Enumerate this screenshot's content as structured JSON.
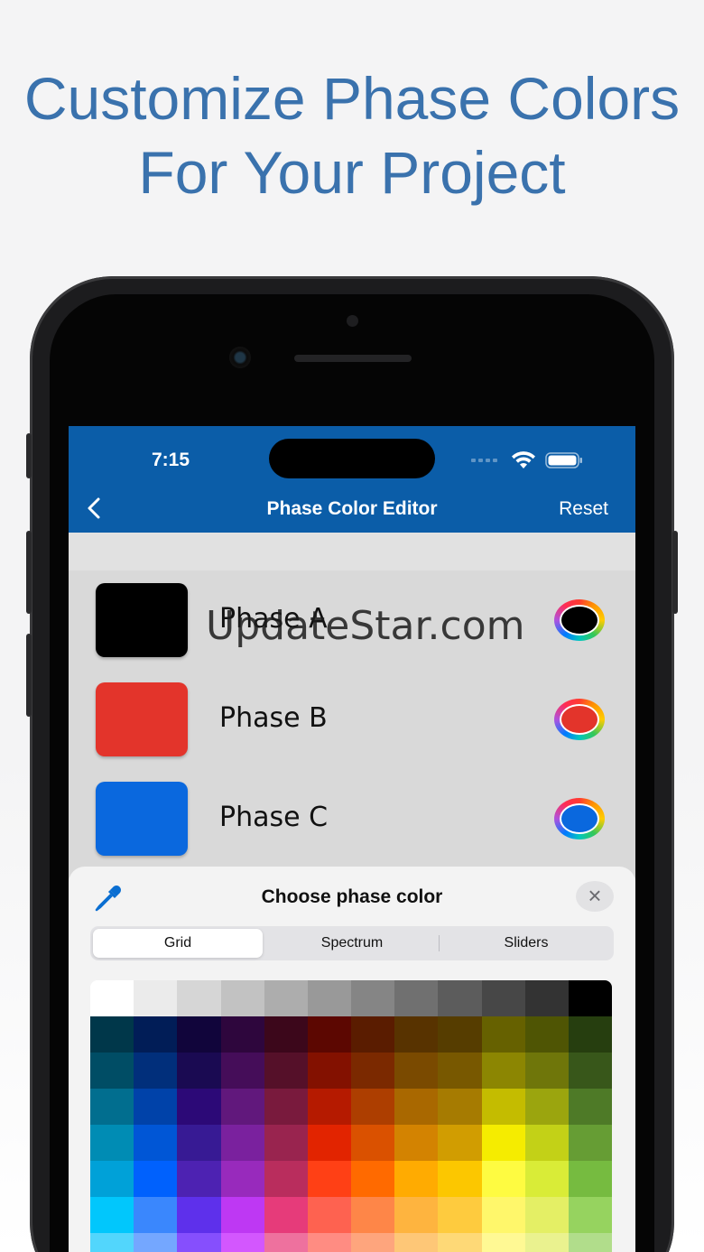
{
  "headline": {
    "line1": "Customize Phase Colors",
    "line2": "For Your Project"
  },
  "status_bar": {
    "time": "7:15"
  },
  "nav": {
    "back_icon": "chevron-left-icon",
    "title": "Phase Color Editor",
    "reset": "Reset"
  },
  "phases": [
    {
      "label": "Phase A",
      "color": "#000000"
    },
    {
      "label": "Phase B",
      "color": "#e3342b"
    },
    {
      "label": "Phase C",
      "color": "#0a68de"
    }
  ],
  "watermark": "UpdateStar.com",
  "sheet": {
    "title": "Choose phase color",
    "eyedropper_icon": "eyedropper-icon",
    "close_icon": "close-icon",
    "tabs": [
      "Grid",
      "Spectrum",
      "Sliders"
    ],
    "active_tab": "Grid"
  },
  "palette": [
    [
      "#ffffff",
      "#ebebeb",
      "#d6d6d6",
      "#c2c2c2",
      "#adadad",
      "#999999",
      "#858585",
      "#707070",
      "#5c5c5c",
      "#474747",
      "#333333",
      "#000000"
    ],
    [
      "#00374a",
      "#011d57",
      "#11053b",
      "#2e063d",
      "#3c071b",
      "#5c0701",
      "#5a1c00",
      "#583300",
      "#563d00",
      "#666100",
      "#4f5504",
      "#263e0f"
    ],
    [
      "#004d65",
      "#012f7b",
      "#1a0a52",
      "#450d59",
      "#551029",
      "#831100",
      "#7b2900",
      "#7a4a00",
      "#785800",
      "#8c8602",
      "#6f760a",
      "#38571a"
    ],
    [
      "#016e8f",
      "#0042a9",
      "#2c0977",
      "#61187c",
      "#791a3d",
      "#b51a00",
      "#ad3e00",
      "#a96800",
      "#a67b01",
      "#c4bc00",
      "#9ba50e",
      "#4e7a27"
    ],
    [
      "#008cb4",
      "#0056d6",
      "#371a94",
      "#7a219e",
      "#99244f",
      "#e22400",
      "#da5100",
      "#d38301",
      "#d19d01",
      "#f5ec00",
      "#c3d117",
      "#669d34"
    ],
    [
      "#00a1d8",
      "#0061fd",
      "#4d22b2",
      "#982abc",
      "#b92d5d",
      "#ff4015",
      "#ff6a00",
      "#ffab01",
      "#fcc700",
      "#fefb41",
      "#d9ec37",
      "#76bb40"
    ],
    [
      "#01c7fc",
      "#3a87fd",
      "#5e30eb",
      "#be38f3",
      "#e63b7a",
      "#fe6250",
      "#fe8648",
      "#feb43f",
      "#fecb3e",
      "#fff76b",
      "#e4ef65",
      "#96d35f"
    ],
    [
      "#52d6fc",
      "#74a7ff",
      "#864ffd",
      "#d357fe",
      "#ee719e",
      "#ff8c82",
      "#fea57d",
      "#fec777",
      "#fed977",
      "#fff994",
      "#eaf28f",
      "#b1dd8b"
    ]
  ]
}
